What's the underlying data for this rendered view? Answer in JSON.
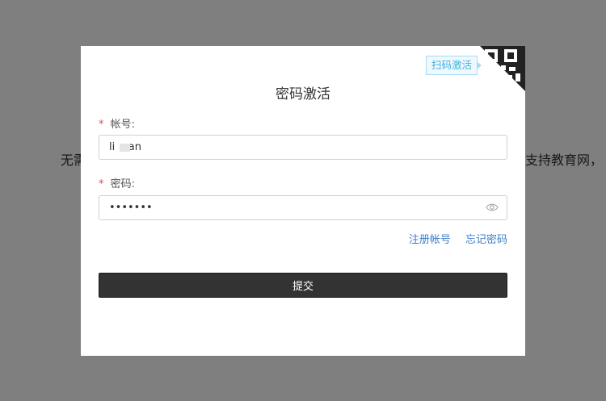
{
  "background": {
    "text_left": "无需",
    "text_right": "支持教育网，"
  },
  "modal": {
    "scan_tag": "扫码激活",
    "qr_icon": "qr-code-icon",
    "title": "密码激活",
    "account": {
      "required_mark": "*",
      "label": "帐号:",
      "value": "li    an"
    },
    "password": {
      "required_mark": "*",
      "label": "密码:",
      "value": "•••••••",
      "toggle_icon": "eye-icon"
    },
    "links": {
      "register": "注册帐号",
      "forgot": "忘记密码"
    },
    "submit_label": "提交"
  },
  "colors": {
    "overlay": "#808080",
    "submit_bg": "#333333",
    "link": "#3d7fc6",
    "required": "#e04a4a",
    "scan_tag": "#3fb3e0"
  }
}
